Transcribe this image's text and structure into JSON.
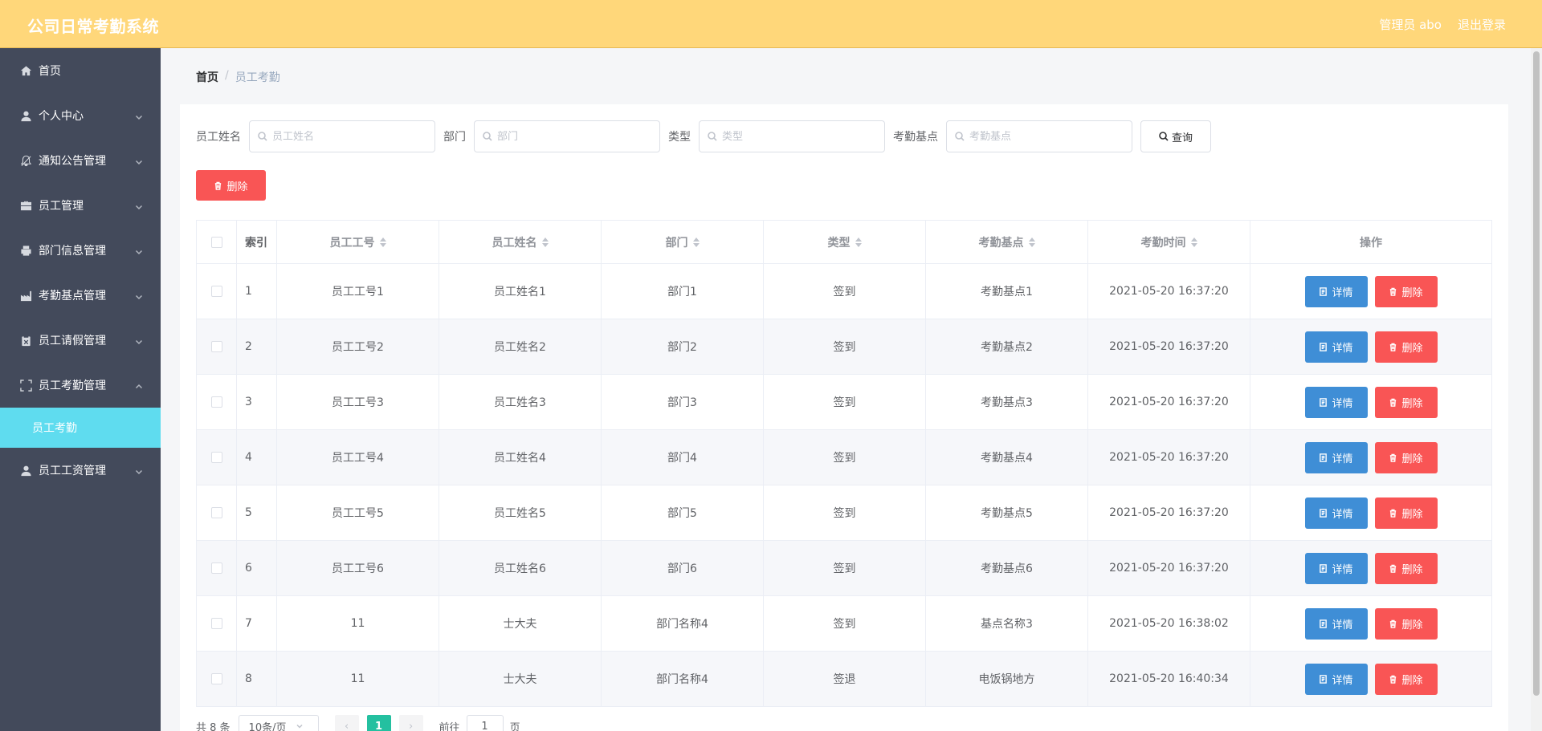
{
  "header": {
    "title": "公司日常考勤系统",
    "admin_label": "管理员 abo",
    "logout_label": "退出登录"
  },
  "sidebar": {
    "items": [
      {
        "label": "首页",
        "icon": "home-icon",
        "expandable": false
      },
      {
        "label": "个人中心",
        "icon": "user-icon",
        "expandable": true
      },
      {
        "label": "通知公告管理",
        "icon": "bell-off-icon",
        "expandable": true
      },
      {
        "label": "员工管理",
        "icon": "briefcase-icon",
        "expandable": true
      },
      {
        "label": "部门信息管理",
        "icon": "printer-icon",
        "expandable": true
      },
      {
        "label": "考勤基点管理",
        "icon": "factory-icon",
        "expandable": true
      },
      {
        "label": "员工请假管理",
        "icon": "clipboard-x-icon",
        "expandable": true
      },
      {
        "label": "员工考勤管理",
        "icon": "fullscreen-icon",
        "expandable": true,
        "open": true
      },
      {
        "label": "员工工资管理",
        "icon": "user-icon",
        "expandable": true
      }
    ],
    "sub_item": "员工考勤"
  },
  "breadcrumb": {
    "home": "首页",
    "separator": "/",
    "current": "员工考勤"
  },
  "search": {
    "name_label": "员工姓名",
    "name_placeholder": "员工姓名",
    "dept_label": "部门",
    "dept_placeholder": "部门",
    "type_label": "类型",
    "type_placeholder": "类型",
    "point_label": "考勤基点",
    "point_placeholder": "考勤基点",
    "query_label": "查询"
  },
  "toolbar": {
    "bulk_delete_label": "删除"
  },
  "table": {
    "headers": {
      "index": "索引",
      "emp_no": "员工工号",
      "emp_name": "员工姓名",
      "dept": "部门",
      "type": "类型",
      "point": "考勤基点",
      "time": "考勤时间",
      "ops": "操作"
    },
    "detail_label": "详情",
    "delete_label": "删除",
    "rows": [
      {
        "index": "1",
        "emp_no": "员工工号1",
        "emp_name": "员工姓名1",
        "dept": "部门1",
        "type": "签到",
        "point": "考勤基点1",
        "time": "2021-05-20 16:37:20"
      },
      {
        "index": "2",
        "emp_no": "员工工号2",
        "emp_name": "员工姓名2",
        "dept": "部门2",
        "type": "签到",
        "point": "考勤基点2",
        "time": "2021-05-20 16:37:20"
      },
      {
        "index": "3",
        "emp_no": "员工工号3",
        "emp_name": "员工姓名3",
        "dept": "部门3",
        "type": "签到",
        "point": "考勤基点3",
        "time": "2021-05-20 16:37:20"
      },
      {
        "index": "4",
        "emp_no": "员工工号4",
        "emp_name": "员工姓名4",
        "dept": "部门4",
        "type": "签到",
        "point": "考勤基点4",
        "time": "2021-05-20 16:37:20"
      },
      {
        "index": "5",
        "emp_no": "员工工号5",
        "emp_name": "员工姓名5",
        "dept": "部门5",
        "type": "签到",
        "point": "考勤基点5",
        "time": "2021-05-20 16:37:20"
      },
      {
        "index": "6",
        "emp_no": "员工工号6",
        "emp_name": "员工姓名6",
        "dept": "部门6",
        "type": "签到",
        "point": "考勤基点6",
        "time": "2021-05-20 16:37:20"
      },
      {
        "index": "7",
        "emp_no": "11",
        "emp_name": "士大夫",
        "dept": "部门名称4",
        "type": "签到",
        "point": "基点名称3",
        "time": "2021-05-20 16:38:02"
      },
      {
        "index": "8",
        "emp_no": "11",
        "emp_name": "士大夫",
        "dept": "部门名称4",
        "type": "签退",
        "point": "电饭锅地方",
        "time": "2021-05-20 16:40:34"
      }
    ]
  },
  "pagination": {
    "total": "共 8 条",
    "page_size": "10条/页",
    "current_page": "1",
    "goto_prefix": "前往",
    "goto_value": "1",
    "goto_suffix": "页"
  },
  "colors": {
    "header_bg": "#ffd77a",
    "sidebar_bg": "#434a5b",
    "active_sub_bg": "#5fdcef",
    "detail_btn": "#3f8ed6",
    "delete_btn": "#f95555",
    "page_active": "#24c0a0"
  }
}
